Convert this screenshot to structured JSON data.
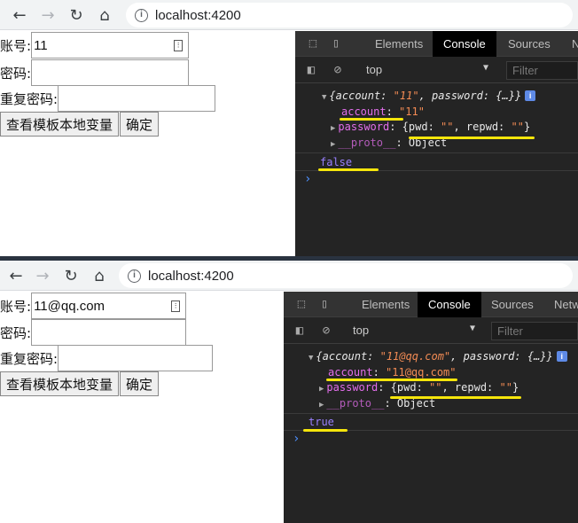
{
  "screens": [
    {
      "address": "localhost:4200",
      "form": {
        "account_label": "账号:",
        "account_value": "11",
        "password_label": "密码:",
        "password_value": "",
        "repeat_label": "重复密码:",
        "repeat_value": "",
        "view_button": "查看模板本地变量",
        "confirm_button": "确定"
      },
      "console": {
        "obj_open": "{account: ",
        "obj_account_val": "\"11\"",
        "obj_mid": ", password: ",
        "obj_close": "{…}}",
        "account_key": "account",
        "account_colon": ": ",
        "account_val": "\"11\"",
        "password_key": "password",
        "password_colon": ": ",
        "password_val_open": "{pwd: ",
        "pwd_val": "\"\"",
        "repwd_sep": ", repwd: ",
        "repwd_val": "\"\"",
        "password_val_close": "}",
        "proto_key": "__proto__",
        "proto_colon": ": ",
        "proto_val": "Object",
        "result": "false"
      }
    },
    {
      "address": "localhost:4200",
      "form": {
        "account_label": "账号:",
        "account_value": "11@qq.com",
        "password_label": "密码:",
        "password_value": "",
        "repeat_label": "重复密码:",
        "repeat_value": "",
        "view_button": "查看模板本地变量",
        "confirm_button": "确定"
      },
      "console": {
        "obj_open": "{account: ",
        "obj_account_val": "\"11@qq.com\"",
        "obj_mid": ", password: ",
        "obj_close": "{…}}",
        "account_key": "account",
        "account_colon": ": ",
        "account_val": "\"11@qq.com\"",
        "password_key": "password",
        "password_colon": ": ",
        "password_val_open": "{pwd: ",
        "pwd_val": "\"\"",
        "repwd_sep": ", repwd: ",
        "repwd_val": "\"\"",
        "password_val_close": "}",
        "proto_key": "__proto__",
        "proto_colon": ": ",
        "proto_val": "Object",
        "result": "true"
      }
    }
  ],
  "devtools": {
    "tab_elements": "Elements",
    "tab_console": "Console",
    "tab_sources": "Sources",
    "tab_more_1": "N",
    "tab_more_2": "Netw",
    "context": "top",
    "filter_placeholder": "Filter",
    "info_badge": "i",
    "prompt": "›"
  },
  "icons": {
    "back": "arrow-left-icon",
    "forward": "arrow-right-icon",
    "reload": "reload-icon",
    "home": "home-icon",
    "info": "info-icon",
    "inspect": "inspect-element-icon",
    "device": "device-toolbar-icon",
    "sidebar": "console-sidebar-icon",
    "clear": "clear-console-icon",
    "keyboard": "keyboard-icon"
  },
  "colors": {
    "highlight": "#f5e50b",
    "devtools_bg": "#242424",
    "key": "#e36eec",
    "string": "#f28b54",
    "boolean": "#9980ff",
    "active_tab": "#000000"
  }
}
